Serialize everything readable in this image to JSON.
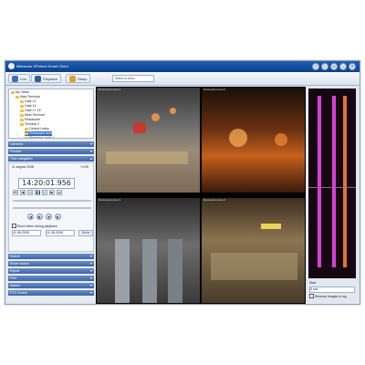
{
  "window": {
    "title": "Milestone XProtect Smart Client",
    "controls": [
      "?",
      "i",
      "▭",
      "–",
      "✕"
    ]
  },
  "toolbar": {
    "live_label": "Live",
    "playback_label": "Playback",
    "setup_label": "Setup",
    "view_select": "Select a view..."
  },
  "tree": {
    "items": [
      {
        "label": "My Views",
        "indent": 0,
        "selected": false
      },
      {
        "label": "Main Terminal",
        "indent": 1,
        "selected": false
      },
      {
        "label": "Gate 12",
        "indent": 2,
        "selected": false
      },
      {
        "label": "Gate 14",
        "indent": 2,
        "selected": false
      },
      {
        "label": "Gate 17-18",
        "indent": 2,
        "selected": false
      },
      {
        "label": "Main Terminal",
        "indent": 2,
        "selected": false
      },
      {
        "label": "Restaurant",
        "indent": 2,
        "selected": false
      },
      {
        "label": "Terminal 2",
        "indent": 2,
        "selected": false
      },
      {
        "label": "Central Lobby",
        "indent": 3,
        "selected": false
      },
      {
        "label": "Restaurant area",
        "indent": 3,
        "selected": true
      },
      {
        "label": "Shopping Level 1",
        "indent": 3,
        "selected": false
      }
    ]
  },
  "panels": {
    "camera_section": "Cameras",
    "preview_section": "Preview",
    "time_section": "Time navigation",
    "date_label": "11 august 2008",
    "zoom_label": "+1:00",
    "time_value": "14:20:01.956",
    "start_date": "11-08-2008",
    "end_date": "11-08-2008",
    "sync_label": "Show video during playback",
    "go_label": "Go to",
    "bottom_sections": [
      "Search",
      "Smart search",
      "Export",
      "Print",
      "Alarms",
      "PTZ Control"
    ]
  },
  "video": {
    "tiles": [
      {
        "label": "Restaurant area 1"
      },
      {
        "label": "Restaurant area 2"
      },
      {
        "label": "Restaurant area 3"
      },
      {
        "label": "Restaurant area 4"
      }
    ]
  },
  "timeline": {
    "camera_label": "Start",
    "duration_label": "5 min",
    "checkbox_label": "Reverse images in log",
    "colors": {
      "motion": "#d640d6",
      "recording": "#e8703a"
    }
  }
}
